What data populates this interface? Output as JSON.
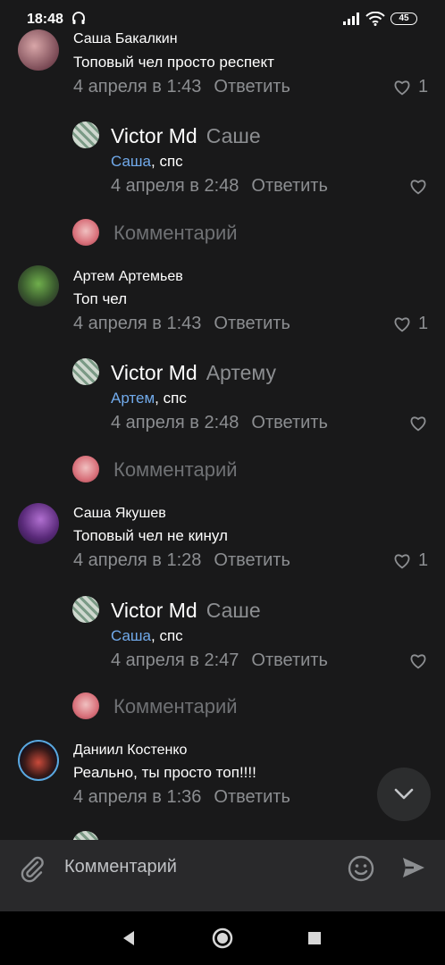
{
  "status_bar": {
    "time": "18:48",
    "battery": "45"
  },
  "threads": [
    {
      "author": "Саша Бакалкин",
      "text": "Топовый чел просто респект",
      "date": "4 апреля в 1:43",
      "reply_label": "Ответить",
      "likes": "1",
      "reply": {
        "author": "Victor Md",
        "to": "Саше",
        "mention": "Саша",
        "text": ", спс",
        "date": "4 апреля в 2:48",
        "reply_label": "Ответить"
      },
      "comment_prompt": "Комментарий"
    },
    {
      "author": "Артем Артемьев",
      "text": "Топ чел",
      "date": "4 апреля в 1:43",
      "reply_label": "Ответить",
      "likes": "1",
      "reply": {
        "author": "Victor Md",
        "to": "Артему",
        "mention": "Артем",
        "text": ", спс",
        "date": "4 апреля в 2:48",
        "reply_label": "Ответить"
      },
      "comment_prompt": "Комментарий"
    },
    {
      "author": "Саша Якушев",
      "text": "Топовый чел не кинул",
      "date": "4 апреля в 1:28",
      "reply_label": "Ответить",
      "likes": "1",
      "reply": {
        "author": "Victor Md",
        "to": "Саше",
        "mention": "Саша",
        "text": ", спс",
        "date": "4 апреля в 2:47",
        "reply_label": "Ответить"
      },
      "comment_prompt": "Комментарий"
    },
    {
      "author": "Даниил Костенко",
      "text": "Реально, ты просто топ!!!!",
      "date": "4 апреля в 1:36",
      "reply_label": "Ответить"
    }
  ],
  "composer": {
    "placeholder": "Комментарий"
  },
  "colors": {
    "background": "#19191a",
    "secondary_text": "#8c8e91",
    "link": "#71aaeb",
    "composer_bg": "#29292b"
  }
}
